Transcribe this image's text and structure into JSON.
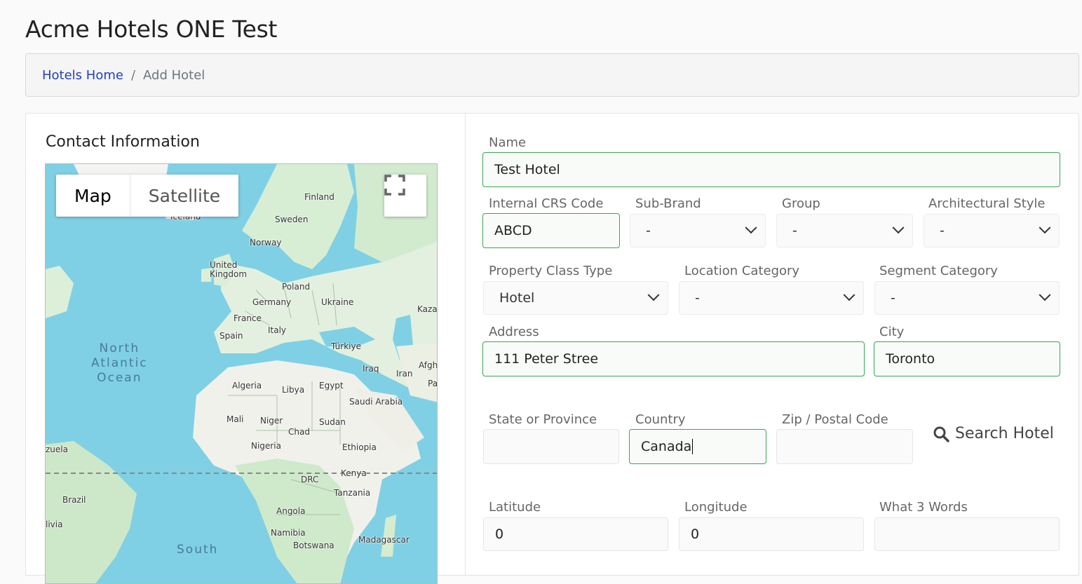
{
  "app_title": "Acme Hotels ONE Test",
  "breadcrumb": {
    "home": "Hotels Home",
    "separator": "/",
    "current": "Add Hotel"
  },
  "contact_section": {
    "title": "Contact Information"
  },
  "map": {
    "toggle": {
      "map": "Map",
      "satellite": "Satellite"
    },
    "fullscreen_icon": "fullscreen-icon",
    "ocean_labels": {
      "north_atlantic": [
        "North",
        "Atlantic",
        "Ocean"
      ],
      "south": "South"
    },
    "place_labels": {
      "finland": "Finland",
      "sweden": "Sweden",
      "iceland": "Iceland",
      "norway": "Norway",
      "united_kingdom": [
        "United",
        "Kingdom"
      ],
      "poland": "Poland",
      "germany": "Germany",
      "ukraine": "Ukraine",
      "kaza": "Kaza",
      "france": "France",
      "italy": "Italy",
      "spain": "Spain",
      "turkiye": "Türkiye",
      "iraq": "Iraq",
      "iran": "Iran",
      "afgh": "Afgh",
      "pa": "Pa",
      "algeria": "Algeria",
      "libya": "Libya",
      "egypt": "Egypt",
      "saudi_arabia": "Saudi Arabia",
      "mali": "Mali",
      "niger": "Niger",
      "chad": "Chad",
      "sudan": "Sudan",
      "nigeria": "Nigeria",
      "ethiopia": "Ethiopia",
      "zuela": "zuela",
      "kenya": "Kenya",
      "drc": "DRC",
      "tanzania": "Tanzania",
      "brazil": "Brazil",
      "angola": "Angola",
      "livia": "livia",
      "namibia": "Namibia",
      "botswana": "Botswana",
      "madagascar": "Madagascar"
    }
  },
  "form": {
    "name": {
      "label": "Name",
      "value": "Test Hotel"
    },
    "crs_code": {
      "label": "Internal CRS Code",
      "value": "ABCD"
    },
    "sub_brand": {
      "label": "Sub-Brand",
      "value": "-"
    },
    "group": {
      "label": "Group",
      "value": "-"
    },
    "arch_style": {
      "label": "Architectural Style",
      "value": "-"
    },
    "property_class": {
      "label": "Property Class Type",
      "value": "Hotel"
    },
    "location_category": {
      "label": "Location Category",
      "value": "-"
    },
    "segment_category": {
      "label": "Segment Category",
      "value": "-"
    },
    "address": {
      "label": "Address",
      "value": "111 Peter Stree"
    },
    "city": {
      "label": "City",
      "value": "Toronto"
    },
    "state": {
      "label": "State or Province",
      "value": ""
    },
    "country": {
      "label": "Country",
      "value": "Canada"
    },
    "zip": {
      "label": "Zip / Postal Code",
      "value": ""
    },
    "search_hotel": {
      "label": "Search Hotel",
      "icon": "search-icon"
    },
    "latitude": {
      "label": "Latitude",
      "value": "0"
    },
    "longitude": {
      "label": "Longitude",
      "value": "0"
    },
    "w3w": {
      "label": "What 3 Words",
      "value": ""
    }
  },
  "colors": {
    "valid_border": "#3aa657",
    "link": "#1f3fc6",
    "ocean": "#7fd0e4",
    "land": "#dcefd8"
  }
}
